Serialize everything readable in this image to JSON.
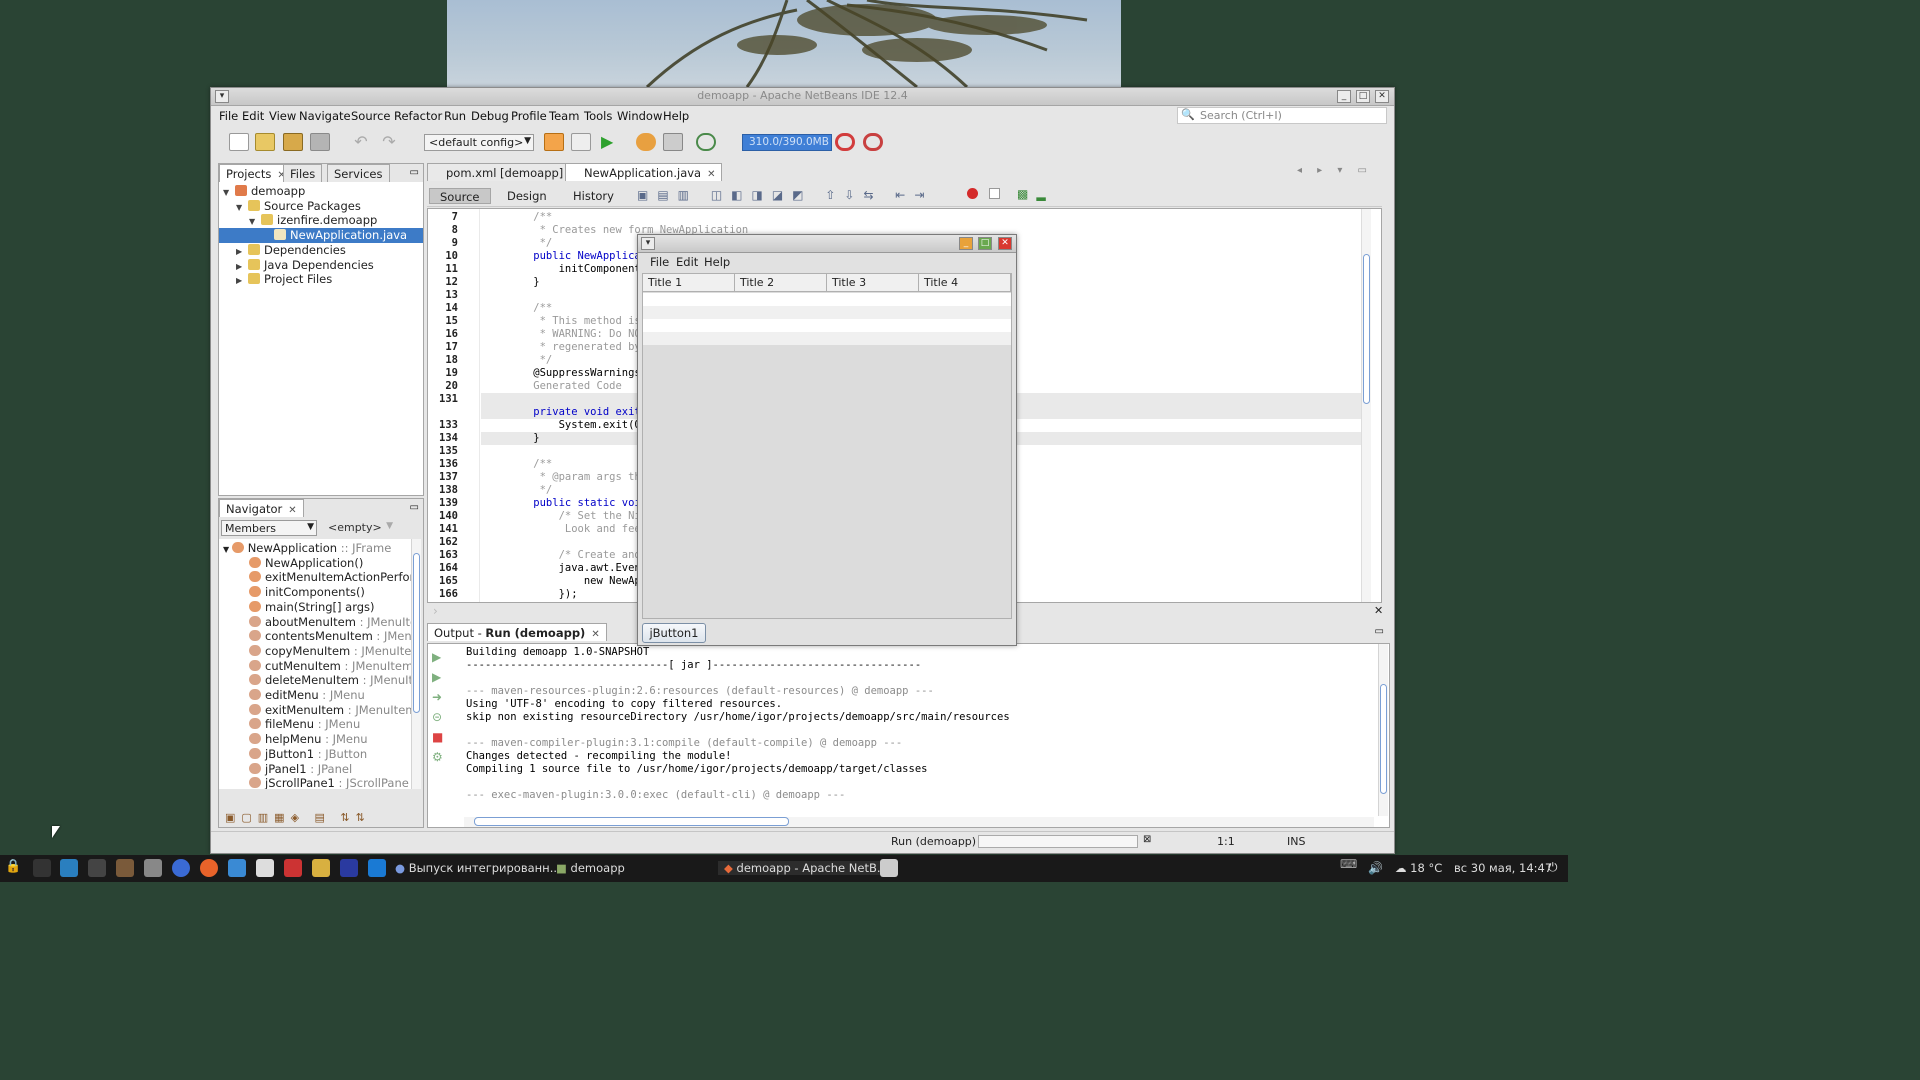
{
  "window": {
    "title": "demoapp - Apache NetBeans IDE 12.4",
    "controls": [
      "minimize-icon",
      "maximize-icon",
      "close-icon"
    ]
  },
  "menubar": [
    "File",
    "Edit",
    "View",
    "Navigate",
    "Source",
    "Refactor",
    "Run",
    "Debug",
    "Profile",
    "Team",
    "Tools",
    "Window",
    "Help"
  ],
  "search": {
    "placeholder": "Search (Ctrl+I)"
  },
  "toolbar": {
    "config": "<default config>",
    "memory": "310.0/390.0MB"
  },
  "projects_panel": {
    "tabs": [
      "Projects",
      "Files",
      "Services"
    ],
    "tree": [
      {
        "label": "demoapp",
        "indent": 0,
        "expanded": true
      },
      {
        "label": "Source Packages",
        "indent": 1,
        "expanded": true
      },
      {
        "label": "izenfire.demoapp",
        "indent": 2,
        "expanded": true
      },
      {
        "label": "NewApplication.java",
        "indent": 3,
        "selected": true
      },
      {
        "label": "Dependencies",
        "indent": 1,
        "expanded": false
      },
      {
        "label": "Java Dependencies",
        "indent": 1,
        "expanded": false
      },
      {
        "label": "Project Files",
        "indent": 1,
        "expanded": false
      }
    ]
  },
  "navigator": {
    "title": "Navigator",
    "filter": "Members",
    "scope": "<empty>",
    "items": [
      {
        "name": "NewApplication",
        "type": " :: JFrame"
      },
      {
        "name": "NewApplication()",
        "type": ""
      },
      {
        "name": "exitMenuItemActionPerforme",
        "type": ""
      },
      {
        "name": "initComponents()",
        "type": ""
      },
      {
        "name": "main(String[] args)",
        "type": ""
      },
      {
        "name": "aboutMenuItem",
        "type": " : JMenuItem"
      },
      {
        "name": "contentsMenuItem",
        "type": " : JMenuIt"
      },
      {
        "name": "copyMenuItem",
        "type": " : JMenuItem"
      },
      {
        "name": "cutMenuItem",
        "type": " : JMenuItem"
      },
      {
        "name": "deleteMenuItem",
        "type": " : JMenuItem"
      },
      {
        "name": "editMenu",
        "type": " : JMenu"
      },
      {
        "name": "exitMenuItem",
        "type": " : JMenuItem"
      },
      {
        "name": "fileMenu",
        "type": " : JMenu"
      },
      {
        "name": "helpMenu",
        "type": " : JMenu"
      },
      {
        "name": "jButton1",
        "type": " : JButton"
      },
      {
        "name": "jPanel1",
        "type": " : JPanel"
      },
      {
        "name": "jScrollPane1",
        "type": " : JScrollPane"
      }
    ]
  },
  "editor": {
    "tabs": [
      "pom.xml [demoapp]",
      "NewApplication.java"
    ],
    "subtabs": [
      "Source",
      "Design",
      "History"
    ],
    "lines": [
      {
        "n": "7",
        "text": "    /**",
        "cls": "cm"
      },
      {
        "n": "8",
        "text": "     * Creates new form NewApplication",
        "cls": "cm"
      },
      {
        "n": "9",
        "text": "     */",
        "cls": "cm"
      },
      {
        "n": "10",
        "text": "    public NewApplicatio",
        "cls": "kw"
      },
      {
        "n": "11",
        "text": "        initComponents(",
        "cls": ""
      },
      {
        "n": "12",
        "text": "    }",
        "cls": ""
      },
      {
        "n": "13",
        "text": "",
        "cls": ""
      },
      {
        "n": "14",
        "text": "    /**",
        "cls": "cm"
      },
      {
        "n": "15",
        "text": "     * This method is c",
        "cls": "cm"
      },
      {
        "n": "16",
        "text": "     * WARNING: Do NOT ",
        "cls": "cm"
      },
      {
        "n": "17",
        "text": "     * regenerated by t",
        "cls": "cm"
      },
      {
        "n": "18",
        "text": "     */",
        "cls": "cm"
      },
      {
        "n": "19",
        "text": "    @SuppressWarnings(\"",
        "cls": ""
      },
      {
        "n": "20",
        "text": "    Generated Code",
        "cls": "cm"
      },
      {
        "n": "131",
        "text": "",
        "cls": ""
      },
      {
        "n": "",
        "text": "    private void exitMen",
        "cls": "kw"
      },
      {
        "n": "133",
        "text": "        System.exit(0);",
        "cls": ""
      },
      {
        "n": "134",
        "text": "    }",
        "cls": ""
      },
      {
        "n": "135",
        "text": "",
        "cls": ""
      },
      {
        "n": "136",
        "text": "    /**",
        "cls": "cm"
      },
      {
        "n": "137",
        "text": "     * @param args the ",
        "cls": "cm"
      },
      {
        "n": "138",
        "text": "     */",
        "cls": "cm"
      },
      {
        "n": "139",
        "text": "    public static void m",
        "cls": "kw"
      },
      {
        "n": "140",
        "text": "        /* Set the Nimb",
        "cls": "cm"
      },
      {
        "n": "141",
        "text": "         Look and feel ",
        "cls": "cm"
      },
      {
        "n": "162",
        "text": "",
        "cls": ""
      },
      {
        "n": "163",
        "text": "        /* Create and d",
        "cls": "cm"
      },
      {
        "n": "164",
        "text": "        java.awt.EventQ",
        "cls": ""
      },
      {
        "n": "165",
        "text": "            new NewAppli",
        "cls": ""
      },
      {
        "n": "166",
        "text": "        });",
        "cls": ""
      }
    ]
  },
  "popup_app": {
    "menu": [
      "File",
      "Edit",
      "Help"
    ],
    "columns": [
      "Title 1",
      "Title 2",
      "Title 3",
      "Title 4"
    ],
    "button": "jButton1"
  },
  "output": {
    "tab": "Output - ",
    "tab_bold": "Run (demoapp)",
    "lines": [
      {
        "text": "Building demoapp 1.0-SNAPSHOT",
        "cls": ""
      },
      {
        "text": "--------------------------------[ jar ]---------------------------------",
        "cls": ""
      },
      {
        "text": "",
        "cls": ""
      },
      {
        "text": "--- maven-resources-plugin:2.6:resources (default-resources) @ demoapp ---",
        "cls": "g"
      },
      {
        "text": "Using 'UTF-8' encoding to copy filtered resources.",
        "cls": ""
      },
      {
        "text": "skip non existing resourceDirectory /usr/home/igor/projects/demoapp/src/main/resources",
        "cls": ""
      },
      {
        "text": "",
        "cls": ""
      },
      {
        "text": "--- maven-compiler-plugin:3.1:compile (default-compile) @ demoapp ---",
        "cls": "g"
      },
      {
        "text": "Changes detected - recompiling the module!",
        "cls": ""
      },
      {
        "text": "Compiling 1 source file to /usr/home/igor/projects/demoapp/target/classes",
        "cls": ""
      },
      {
        "text": "",
        "cls": ""
      },
      {
        "text": "--- exec-maven-plugin:3.0.0:exec (default-cli) @ demoapp ---",
        "cls": "g"
      }
    ]
  },
  "statusbar": {
    "run": "Run (demoapp)",
    "position": "1:1",
    "mode": "INS"
  },
  "taskbar": {
    "tasks": [
      "Выпуск интегрированн...",
      "demoapp",
      "demoapp - Apache NetB..."
    ],
    "weather": "18 °C",
    "clock": "вс 30 мая, 14:47"
  },
  "colors": {
    "accent": "#3f7fd6",
    "selection": "#3d7bc7",
    "desktop": "#2a4434"
  }
}
